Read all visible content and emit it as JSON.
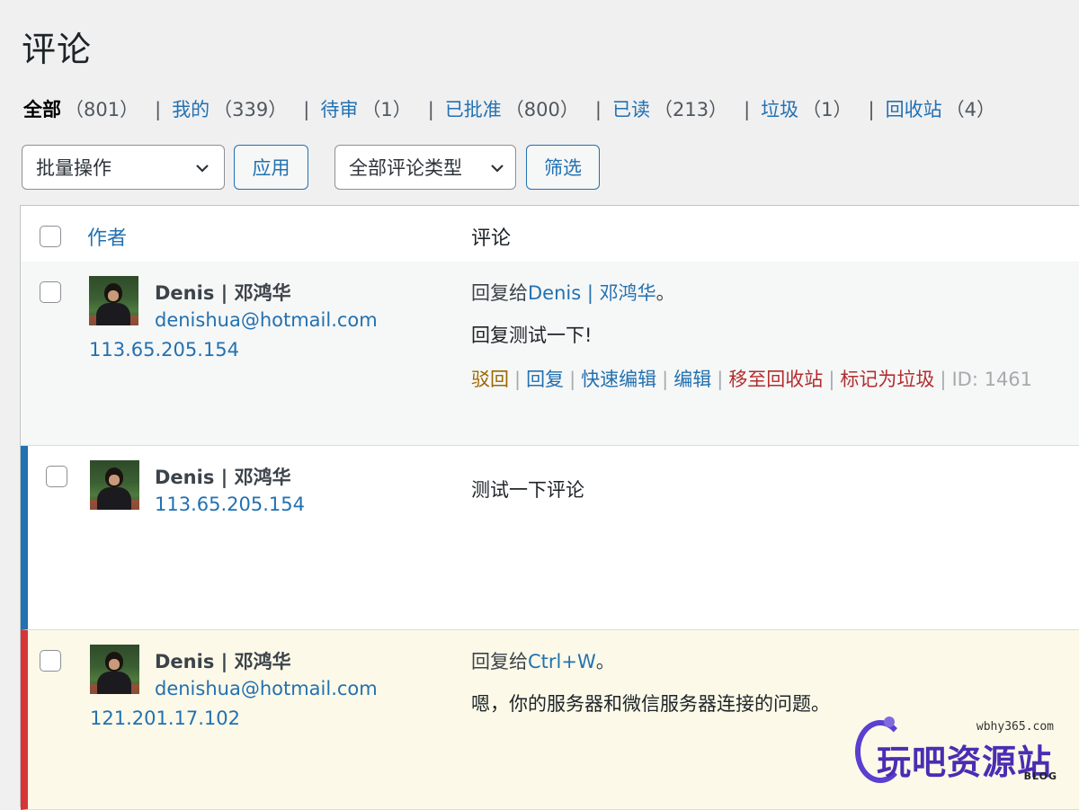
{
  "page": {
    "title": "评论"
  },
  "filters": [
    {
      "label": "全部",
      "count": "（801）",
      "current": true
    },
    {
      "label": "我的",
      "count": "（339）"
    },
    {
      "label": "待审",
      "count": "（1）"
    },
    {
      "label": "已批准",
      "count": "（800）"
    },
    {
      "label": "已读",
      "count": "（213）"
    },
    {
      "label": "垃圾",
      "count": "（1）"
    },
    {
      "label": "回收站",
      "count": "（4）"
    }
  ],
  "filter_separator": "|",
  "toolbar": {
    "bulk_select": "批量操作",
    "apply_label": "应用",
    "type_select": "全部评论类型",
    "filter_label": "筛选"
  },
  "table": {
    "col_author": "作者",
    "col_comment": "评论",
    "rows": [
      {
        "author_name": "Denis | 邓鸿华",
        "author_email": "denishua@hotmail.com",
        "author_ip": "113.65.205.154",
        "reply_prefix": "回复给",
        "reply_target": "Denis | 邓鸿华",
        "reply_suffix": "。",
        "text": "回复测试一下!",
        "status": "highlighted",
        "actions": {
          "unapprove": "驳回",
          "reply": "回复",
          "quick_edit": "快速编辑",
          "edit": "编辑",
          "trash": "移至回收站",
          "spam": "标记为垃圾",
          "id": "ID: 1461",
          "sep": "|"
        }
      },
      {
        "author_name": "Denis | 邓鸿华",
        "author_ip": "113.65.205.154",
        "text": "测试一下评论",
        "status": "approved"
      },
      {
        "author_name": "Denis | 邓鸿华",
        "author_email": "denishua@hotmail.com",
        "author_ip": "121.201.17.102",
        "reply_prefix": "回复给",
        "reply_target": "Ctrl+W",
        "reply_suffix": "。",
        "text": "嗯，你的服务器和微信服务器连接的问题。",
        "status": "pending"
      }
    ]
  },
  "watermark": {
    "url": "wbhy365.com",
    "text": "玩吧资源站",
    "blog": "BLOG"
  },
  "colors": {
    "link": "#2271b1",
    "approved_bar": "#2271b1",
    "pending_bar": "#d63638",
    "pending_bg": "#fcf9e8",
    "unapprove": "#996800",
    "danger": "#b32d2e"
  }
}
